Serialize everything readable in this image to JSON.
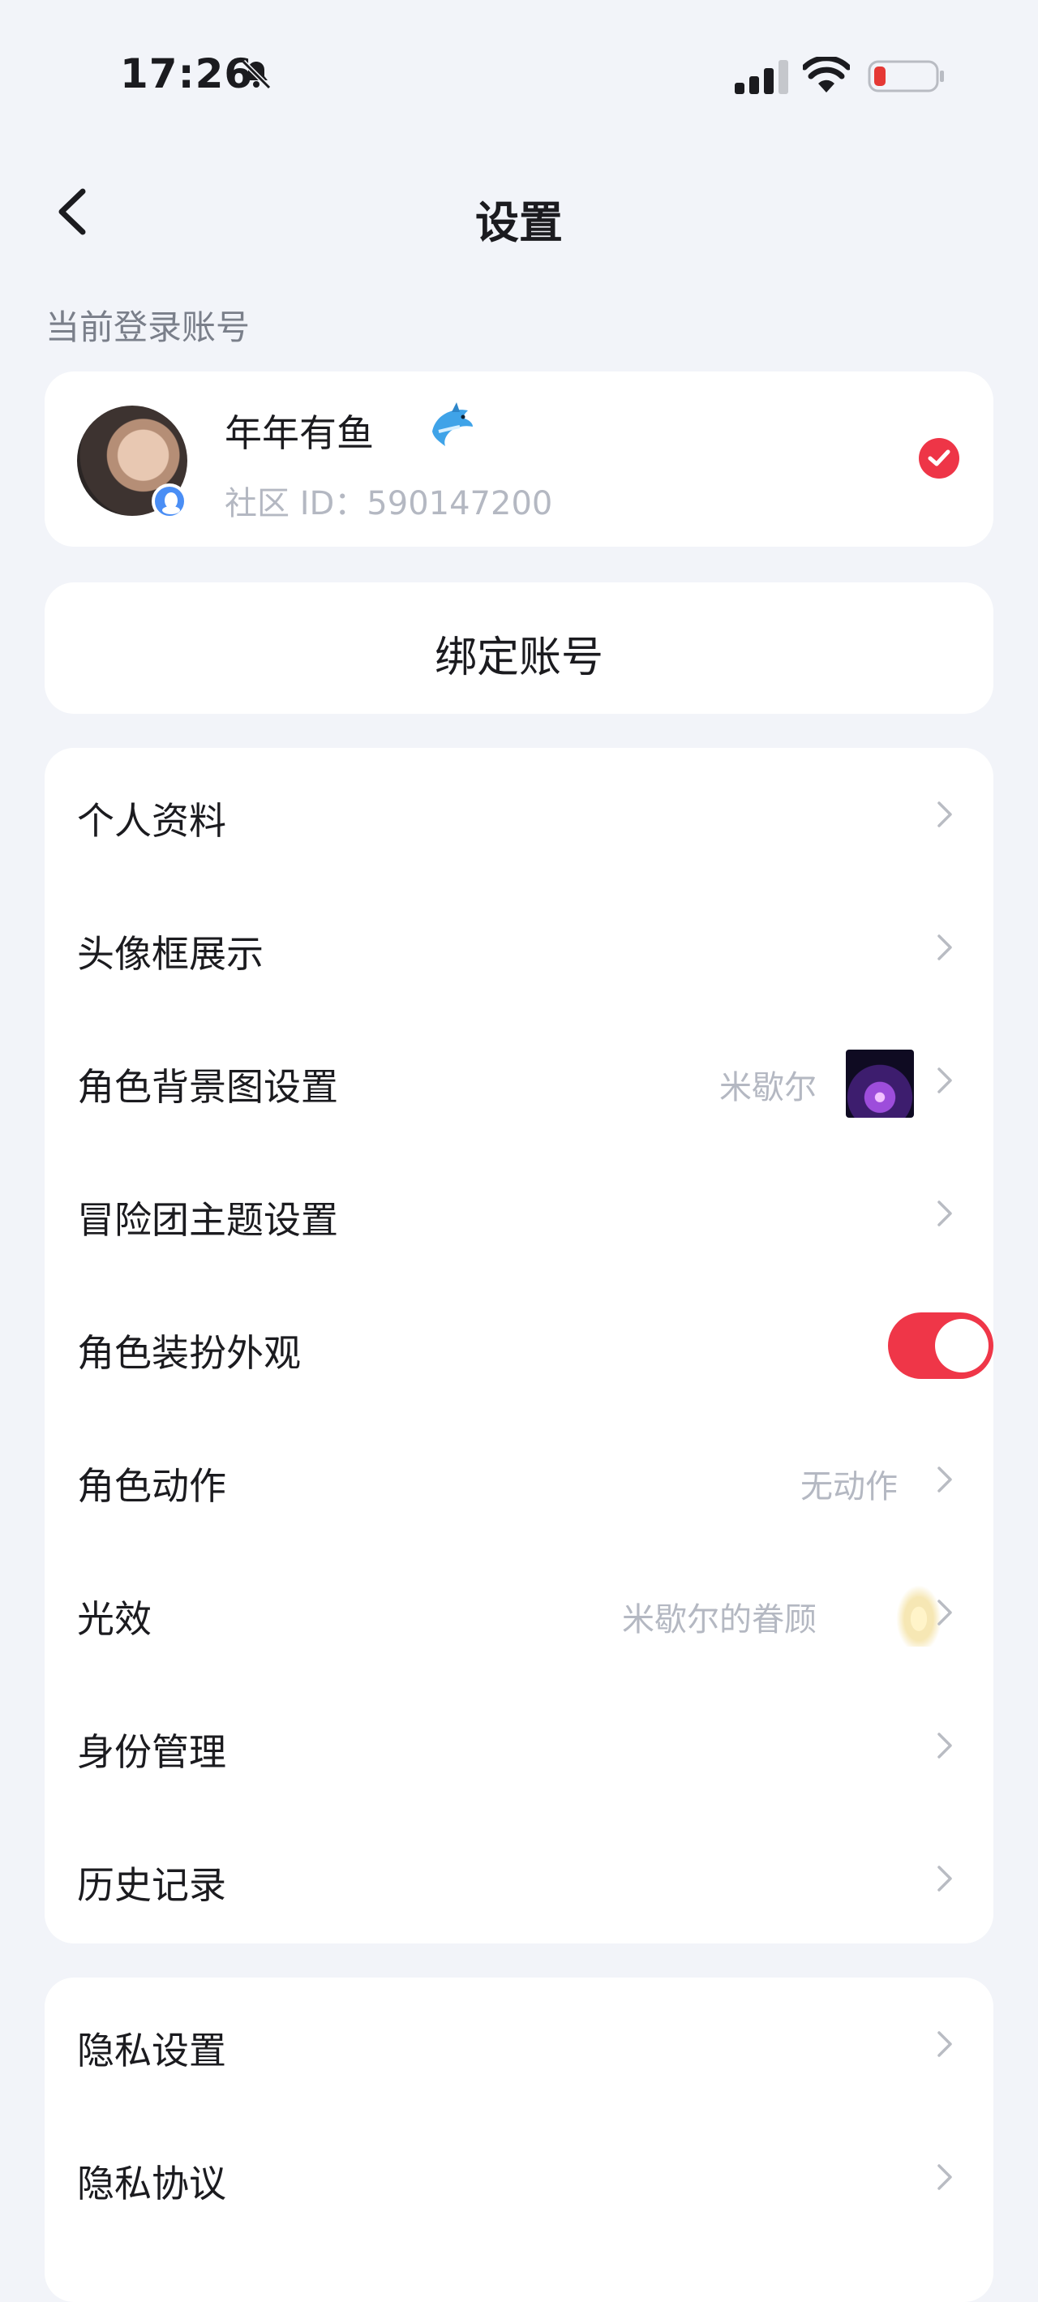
{
  "status_bar": {
    "time": "17:26",
    "icons": [
      "bell-muted-icon",
      "cellular-signal-icon",
      "wifi-icon",
      "battery-low-icon"
    ],
    "battery_color": "#e53935"
  },
  "header": {
    "title": "设置",
    "back_icon": "chevron-left-icon"
  },
  "account_section": {
    "label": "当前登录账号",
    "account": {
      "name": "年年有鱼",
      "emoji": "dolphin-icon",
      "id_text": "社区 ID：590147200",
      "selected": true
    }
  },
  "bind_button": {
    "label": "绑定账号"
  },
  "settings_group_1": [
    {
      "label": "个人资料"
    },
    {
      "label": "头像框展示"
    },
    {
      "label": "角色背景图设置",
      "value": "米歇尔"
    },
    {
      "label": "冒险团主题设置"
    },
    {
      "label": "角色装扮外观",
      "toggle": true
    },
    {
      "label": "角色动作",
      "value": "无动作"
    },
    {
      "label": "光效",
      "value": "米歇尔的眷顾"
    },
    {
      "label": "身份管理"
    },
    {
      "label": "历史记录"
    }
  ],
  "settings_group_2": [
    {
      "label": "隐私设置"
    },
    {
      "label": "隐私协议"
    }
  ],
  "colors": {
    "background": "#f2f4f9",
    "card": "#ffffff",
    "accent_red": "#ef3648",
    "secondary_text": "#b4b8c2",
    "label_gray": "#7a7f8a"
  }
}
